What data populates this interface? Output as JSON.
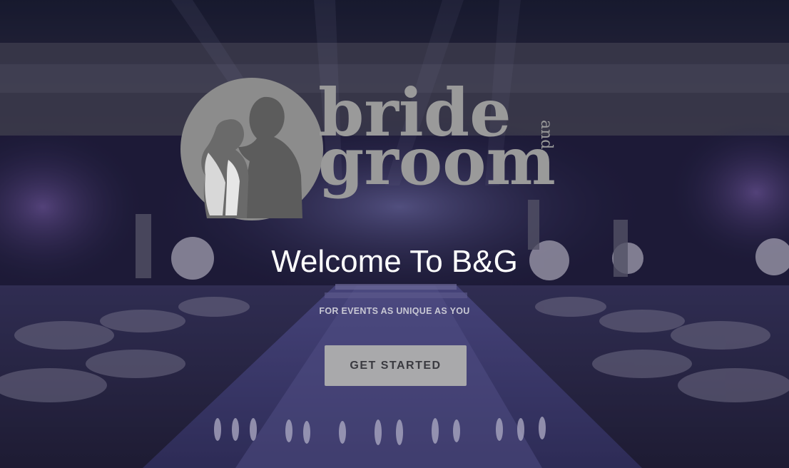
{
  "logo": {
    "word_top": "bride",
    "word_small": "and",
    "word_bottom": "groom"
  },
  "hero": {
    "title": "Welcome To B&G",
    "tagline": "FOR EVENTS AS UNIQUE AS YOU",
    "cta_label": "GET STARTED"
  },
  "colors": {
    "logo_gray": "#9a9a9a",
    "logo_circle": "#8c8c8c",
    "silhouette": "#5a5a5a",
    "button_bg": "#a9a9ab",
    "button_text": "#3a3a40",
    "title_text": "#ffffff",
    "background_tint": "#2a2650"
  },
  "icons": {
    "logo_emblem": "couple-silhouette-icon"
  }
}
